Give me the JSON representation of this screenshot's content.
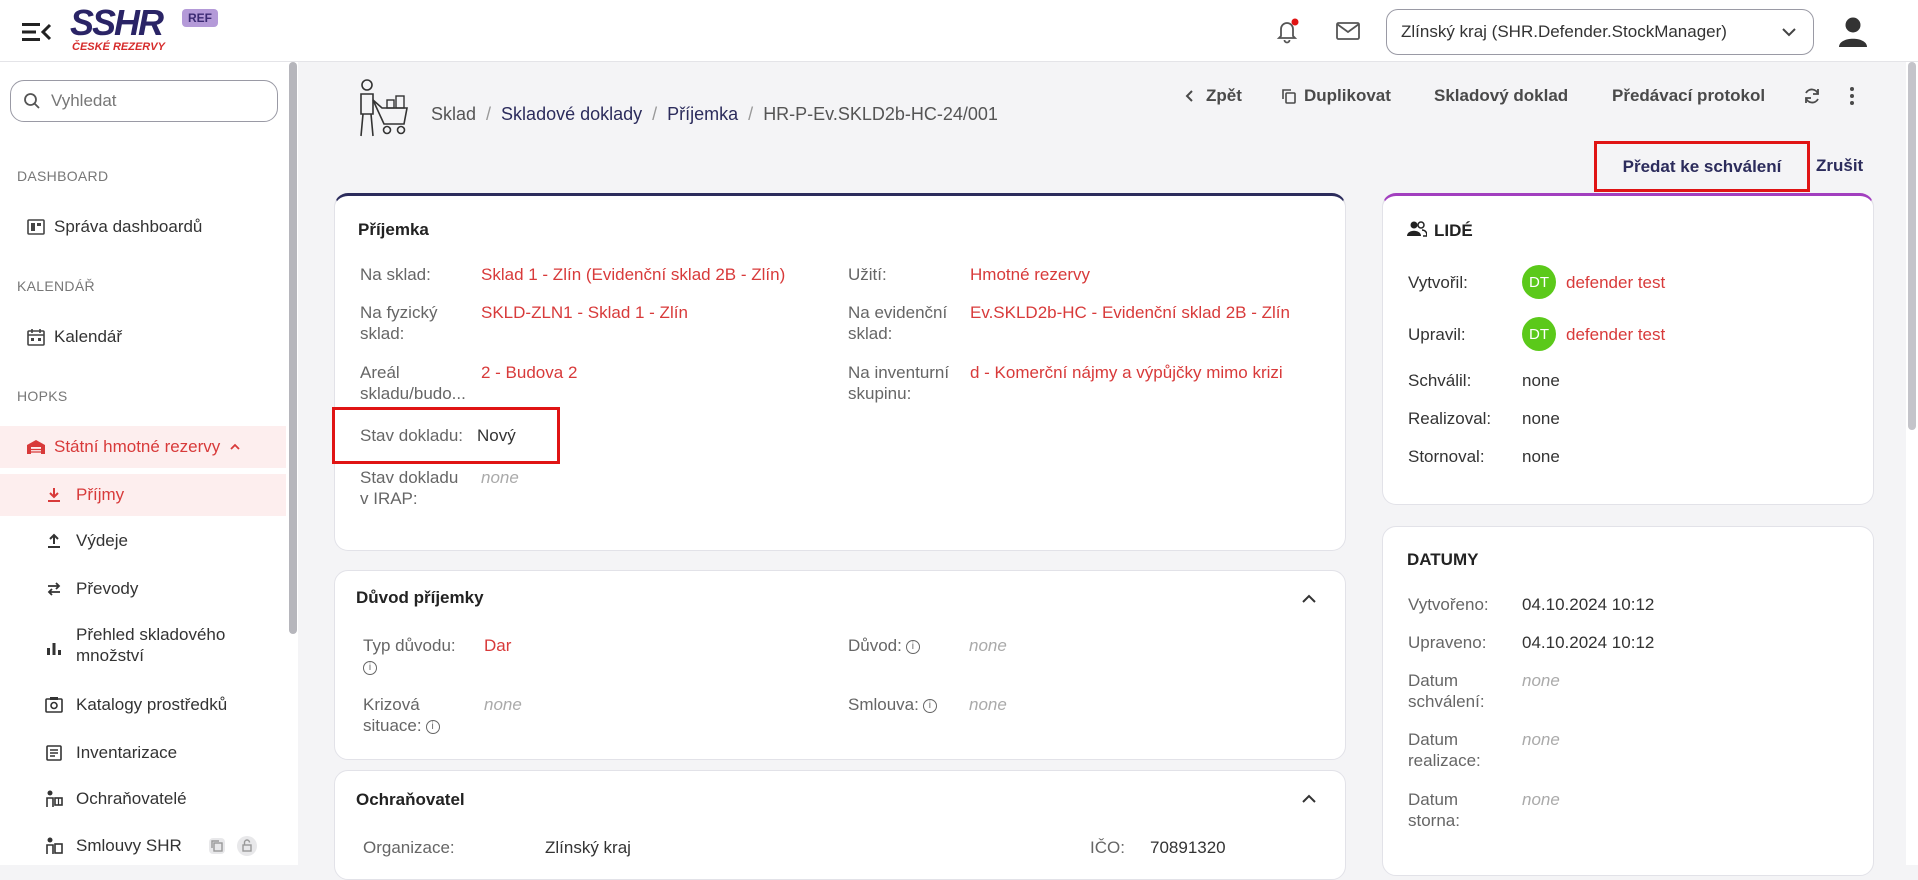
{
  "header": {
    "logo_text": "SSHR",
    "logo_sub": "ČESKÉ REZERVY",
    "env_badge": "REF",
    "org_select_value": "Zlínský kraj (SHR.Defender.StockManager)"
  },
  "sidebar": {
    "search_placeholder": "Vyhledat",
    "sections": {
      "dashboard": "DASHBOARD",
      "calendar": "KALENDÁŘ",
      "hopks": "HOPKS"
    },
    "items": {
      "dashboards": "Správa dashboardů",
      "calendar": "Kalendář",
      "state_reserves": "Státní hmotné rezervy",
      "receipts": "Příjmy",
      "issues": "Výdeje",
      "transfers": "Převody",
      "stock_overview_1": "Přehled skladového",
      "stock_overview_2": "množství",
      "catalogs": "Katalogy prostředků",
      "inventory": "Inventarizace",
      "protectors": "Ochraňovatelé",
      "contracts": "Smlouvy SHR"
    }
  },
  "breadcrumb": {
    "warehouse": "Sklad",
    "documents": "Skladové doklady",
    "receipt": "Příjemka",
    "doc_id": "HR-P-Ev.SKLD2b-HC-24/001"
  },
  "actions": {
    "back": "Zpět",
    "duplicate": "Duplikovat",
    "stock_document": "Skladový doklad",
    "handover_protocol": "Předávací protokol",
    "submit_for_approval": "Předat ke schválení",
    "cancel": "Zrušit"
  },
  "receipt_card": {
    "title": "Příjemka",
    "to_warehouse_label": "Na sklad:",
    "to_warehouse_value": "Sklad 1 - Zlín (Evidenční sklad 2B - Zlín)",
    "physical_label_1": "Na fyzický",
    "physical_label_2": "sklad:",
    "physical_value": "SKLD-ZLN1 - Sklad 1 - Zlín",
    "area_label_1": "Areál",
    "area_label_2": "skladu/budo...",
    "area_value": "2 - Budova 2",
    "status_label": "Stav dokladu:",
    "status_value": "Nový",
    "irap_label_1": "Stav dokladu",
    "irap_label_2": "v IRAP:",
    "irap_value": "none",
    "usage_label": "Užití:",
    "usage_value": "Hmotné rezervy",
    "evidence_label_1": "Na evidenční",
    "evidence_label_2": "sklad:",
    "evidence_value": "Ev.SKLD2b-HC - Evidenční sklad 2B - Zlín",
    "inventory_group_label_1": "Na inventurní",
    "inventory_group_label_2": "skupinu:",
    "inventory_group_value": "d - Komerční nájmy a výpůjčky mimo krizi"
  },
  "reason_card": {
    "title": "Důvod příjemky",
    "type_label": "Typ důvodu:",
    "type_value": "Dar",
    "reason_label": "Důvod:",
    "reason_value": "none",
    "crisis_label_1": "Krizová",
    "crisis_label_2": "situace:",
    "crisis_value": "none",
    "contract_label": "Smlouva:",
    "contract_value": "none"
  },
  "protector_card": {
    "title": "Ochraňovatel",
    "org_label": "Organizace:",
    "org_value": "Zlínský kraj",
    "ico_label": "IČO:",
    "ico_value": "70891320"
  },
  "people_card": {
    "title": "LIDÉ",
    "created_label": "Vytvořil:",
    "created_initials": "DT",
    "created_value": "defender test",
    "modified_label": "Upravil:",
    "modified_initials": "DT",
    "modified_value": "defender test",
    "approved_label": "Schválil:",
    "approved_value": "none",
    "realized_label": "Realizoval:",
    "realized_value": "none",
    "cancelled_label": "Stornoval:",
    "cancelled_value": "none"
  },
  "dates_card": {
    "title": "DATUMY",
    "created_label": "Vytvořeno:",
    "created_value": "04.10.2024 10:12",
    "modified_label": "Upraveno:",
    "modified_value": "04.10.2024 10:12",
    "approval_label_1": "Datum",
    "approval_label_2": "schválení:",
    "approval_value": "none",
    "realization_label_1": "Datum",
    "realization_label_2": "realizace:",
    "realization_value": "none",
    "storno_label_1": "Datum",
    "storno_label_2": "storna:",
    "storno_value": "none"
  },
  "colors": {
    "brand": "#2a2466",
    "accent_red": "#d83a3a",
    "highlight": "#e01414",
    "avatar_green": "#5bc91a"
  }
}
